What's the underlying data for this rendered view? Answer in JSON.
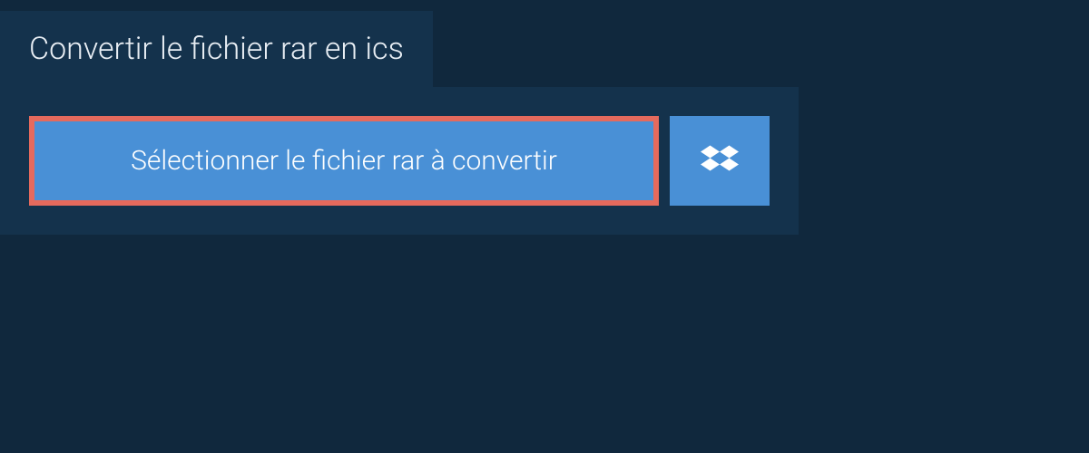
{
  "header": {
    "title": "Convertir le fichier rar en ics"
  },
  "actions": {
    "select_file_label": "Sélectionner le fichier rar à convertir"
  },
  "colors": {
    "background": "#10283d",
    "panel": "#14324c",
    "button": "#4990d6",
    "highlight_border": "#e56a5d",
    "text_light": "#ffffff"
  },
  "icons": {
    "dropbox": "dropbox-icon"
  }
}
